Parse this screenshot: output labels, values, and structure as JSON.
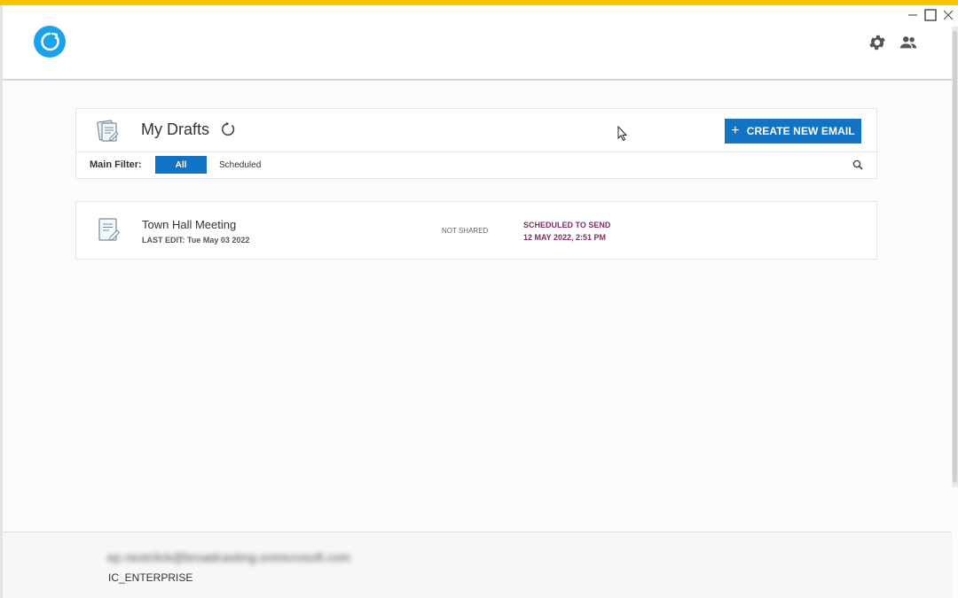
{
  "window": {
    "controls": [
      "minimize",
      "maximize",
      "close"
    ],
    "accent_color": "#f7c600"
  },
  "header": {
    "logo_icon": "app-logo-icon",
    "settings_icon": "gear-icon",
    "users_icon": "users-icon"
  },
  "drafts": {
    "title": "My Drafts",
    "create_button": "CREATE NEW EMAIL",
    "filter_label": "Main Filter:",
    "filters": [
      "All",
      "Scheduled"
    ],
    "active_filter": "All",
    "primary_color": "#1272c4"
  },
  "rows": [
    {
      "title": "Town Hall Meeting",
      "last_edit": "LAST EDIT: Tue May 03 2022",
      "share_status": "NOT SHARED",
      "schedule_label": "SCHEDULED TO SEND",
      "schedule_time": "12 MAY 2022, 2:51 PM",
      "schedule_color": "#7b3166"
    }
  ],
  "footer": {
    "account_email": "ep.nextclick@broadcasting.onmicrosoft.com",
    "plan": "IC_ENTERPRISE"
  }
}
